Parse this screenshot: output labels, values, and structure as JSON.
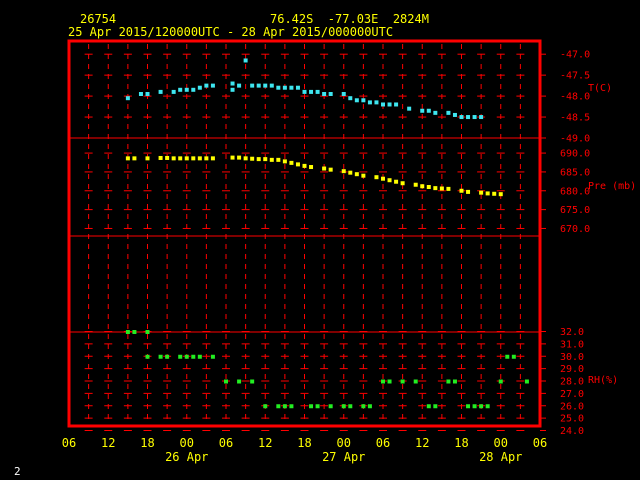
{
  "header": {
    "station_id": "26754",
    "location": "76.42S  -77.03E  2824M",
    "time_range": "25 Apr 2015/120000UTC - 28 Apr 2015/000000UTC"
  },
  "footer": {
    "page_number": "2"
  },
  "chart_data": {
    "type": "scatter",
    "x_ticks": [
      "06",
      "12",
      "18",
      "00",
      "06",
      "12",
      "18",
      "00",
      "06",
      "12",
      "18",
      "00",
      "06"
    ],
    "date_labels": [
      {
        "label": "26 Apr",
        "at_tick": 3
      },
      {
        "label": "27 Apr",
        "at_tick": 7
      },
      {
        "label": "28 Apr",
        "at_tick": 11
      }
    ],
    "x_axis_hours": [
      -18,
      54
    ],
    "x_origin": "2015-04-26 00 UTC",
    "panels": [
      {
        "ylabel": "T(C)",
        "color": "#3ee6f0",
        "y_ticks": [
          -47.0,
          -47.5,
          -48.0,
          -48.5,
          -49.0
        ],
        "y_tick_labels": [
          "-47.0",
          "-47.5",
          "-48.0",
          "-48.5",
          "-49.0"
        ],
        "ylim": [
          -49.0,
          -46.9
        ],
        "points": [
          [
            -9,
            -48.05
          ],
          [
            -7,
            -47.95
          ],
          [
            -6,
            -47.95
          ],
          [
            -4,
            -47.9
          ],
          [
            -2,
            -47.9
          ],
          [
            -1,
            -47.85
          ],
          [
            0,
            -47.85
          ],
          [
            1,
            -47.85
          ],
          [
            2,
            -47.8
          ],
          [
            3,
            -47.75
          ],
          [
            4,
            -47.75
          ],
          [
            7,
            -47.7
          ],
          [
            7,
            -47.85
          ],
          [
            8,
            -47.75
          ],
          [
            9,
            -47.15
          ],
          [
            10,
            -47.75
          ],
          [
            11,
            -47.75
          ],
          [
            12,
            -47.75
          ],
          [
            13,
            -47.75
          ],
          [
            14,
            -47.8
          ],
          [
            15,
            -47.8
          ],
          [
            16,
            -47.8
          ],
          [
            17,
            -47.8
          ],
          [
            18,
            -47.9
          ],
          [
            19,
            -47.9
          ],
          [
            20,
            -47.9
          ],
          [
            21,
            -47.95
          ],
          [
            22,
            -47.95
          ],
          [
            24,
            -47.95
          ],
          [
            25,
            -48.05
          ],
          [
            26,
            -48.1
          ],
          [
            27,
            -48.1
          ],
          [
            28,
            -48.15
          ],
          [
            29,
            -48.15
          ],
          [
            30,
            -48.2
          ],
          [
            31,
            -48.2
          ],
          [
            32,
            -48.2
          ],
          [
            34,
            -48.3
          ],
          [
            36,
            -48.35
          ],
          [
            37,
            -48.35
          ],
          [
            38,
            -48.4
          ],
          [
            40,
            -48.4
          ],
          [
            41,
            -48.45
          ],
          [
            42,
            -48.5
          ],
          [
            43,
            -48.5
          ],
          [
            44,
            -48.5
          ],
          [
            45,
            -48.5
          ]
        ]
      },
      {
        "ylabel": "Pre (mb)",
        "color": "#ffff00",
        "y_ticks": [
          690.0,
          685.0,
          680.0,
          675.0,
          670.0
        ],
        "y_tick_labels": [
          "690.0",
          "685.0",
          "680.0",
          "675.0",
          "670.0"
        ],
        "ylim": [
          668.0,
          694.0
        ],
        "points": [
          [
            -9,
            688.6
          ],
          [
            -8,
            688.6
          ],
          [
            -6,
            688.6
          ],
          [
            -4,
            688.7
          ],
          [
            -3,
            688.7
          ],
          [
            -2,
            688.6
          ],
          [
            -1,
            688.6
          ],
          [
            0,
            688.6
          ],
          [
            1,
            688.6
          ],
          [
            2,
            688.6
          ],
          [
            3,
            688.6
          ],
          [
            4,
            688.6
          ],
          [
            7,
            688.8
          ],
          [
            8,
            688.8
          ],
          [
            9,
            688.6
          ],
          [
            10,
            688.5
          ],
          [
            11,
            688.4
          ],
          [
            12,
            688.4
          ],
          [
            13,
            688.2
          ],
          [
            14,
            688.2
          ],
          [
            15,
            687.8
          ],
          [
            16,
            687.4
          ],
          [
            17,
            687.0
          ],
          [
            18,
            686.6
          ],
          [
            19,
            686.3
          ],
          [
            21,
            685.9
          ],
          [
            22,
            685.6
          ],
          [
            24,
            685.2
          ],
          [
            25,
            684.8
          ],
          [
            26,
            684.4
          ],
          [
            27,
            684.0
          ],
          [
            29,
            683.6
          ],
          [
            30,
            683.2
          ],
          [
            31,
            682.8
          ],
          [
            32,
            682.4
          ],
          [
            33,
            682.0
          ],
          [
            35,
            681.6
          ],
          [
            36,
            681.2
          ],
          [
            37,
            681.0
          ],
          [
            38,
            680.7
          ],
          [
            39,
            680.6
          ],
          [
            40,
            680.5
          ],
          [
            42,
            680.0
          ],
          [
            43,
            679.7
          ],
          [
            45,
            679.5
          ],
          [
            46,
            679.3
          ],
          [
            47,
            679.2
          ],
          [
            48,
            679.1
          ]
        ]
      },
      {
        "ylabel": "RH(%)",
        "color": "#22ee22",
        "y_ticks": [
          32.0,
          31.0,
          30.0,
          29.0,
          28.0,
          27.0,
          26.0,
          25.0,
          24.0
        ],
        "y_tick_labels": [
          "32.0",
          "31.0",
          "30.0",
          "29.0",
          "28.0",
          "27.0",
          "26.0",
          "25.0",
          "24.0"
        ],
        "ylim": [
          24.0,
          32.0
        ],
        "points": [
          [
            -9,
            32
          ],
          [
            -8,
            32
          ],
          [
            -6,
            32
          ],
          [
            -6,
            30
          ],
          [
            -4,
            30
          ],
          [
            -3,
            30
          ],
          [
            -1,
            30
          ],
          [
            0,
            30
          ],
          [
            1,
            30
          ],
          [
            2,
            30
          ],
          [
            4,
            30
          ],
          [
            6,
            28
          ],
          [
            8,
            28
          ],
          [
            10,
            28
          ],
          [
            12,
            26
          ],
          [
            14,
            26
          ],
          [
            15,
            26
          ],
          [
            16,
            26
          ],
          [
            19,
            26
          ],
          [
            20,
            26
          ],
          [
            22,
            26
          ],
          [
            24,
            26
          ],
          [
            25,
            26
          ],
          [
            27,
            26
          ],
          [
            28,
            26
          ],
          [
            30,
            28
          ],
          [
            31,
            28
          ],
          [
            33,
            28
          ],
          [
            35,
            28
          ],
          [
            37,
            26
          ],
          [
            38,
            26
          ],
          [
            40,
            28
          ],
          [
            41,
            28
          ],
          [
            43,
            26
          ],
          [
            44,
            26
          ],
          [
            45,
            26
          ],
          [
            46,
            26
          ],
          [
            48,
            28
          ],
          [
            49,
            30
          ],
          [
            50,
            30
          ],
          [
            52,
            28
          ]
        ]
      }
    ]
  }
}
